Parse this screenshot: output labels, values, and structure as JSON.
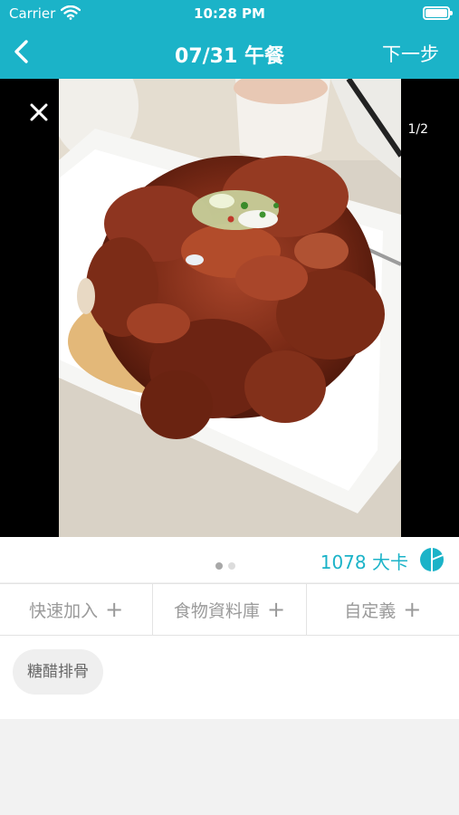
{
  "status_bar": {
    "carrier": "Carrier",
    "time": "10:28 PM"
  },
  "nav": {
    "title": "07/31 午餐",
    "next_label": "下一步"
  },
  "photo": {
    "counter": "1/2",
    "description_icon": "food-photo"
  },
  "pager": {
    "pages": 2,
    "current": 1
  },
  "calories": {
    "value": "1078",
    "unit": "大卡",
    "display": "1078 大卡"
  },
  "actions": [
    {
      "label": "快速加入",
      "icon": "plus-icon"
    },
    {
      "label": "食物資料庫",
      "icon": "plus-icon"
    },
    {
      "label": "自定義",
      "icon": "plus-icon"
    }
  ],
  "tags": [
    {
      "label": "糖醋排骨"
    }
  ],
  "colors": {
    "accent": "#1bb3c8",
    "background": "#f2f2f2",
    "muted_text": "#9a9a9a"
  }
}
